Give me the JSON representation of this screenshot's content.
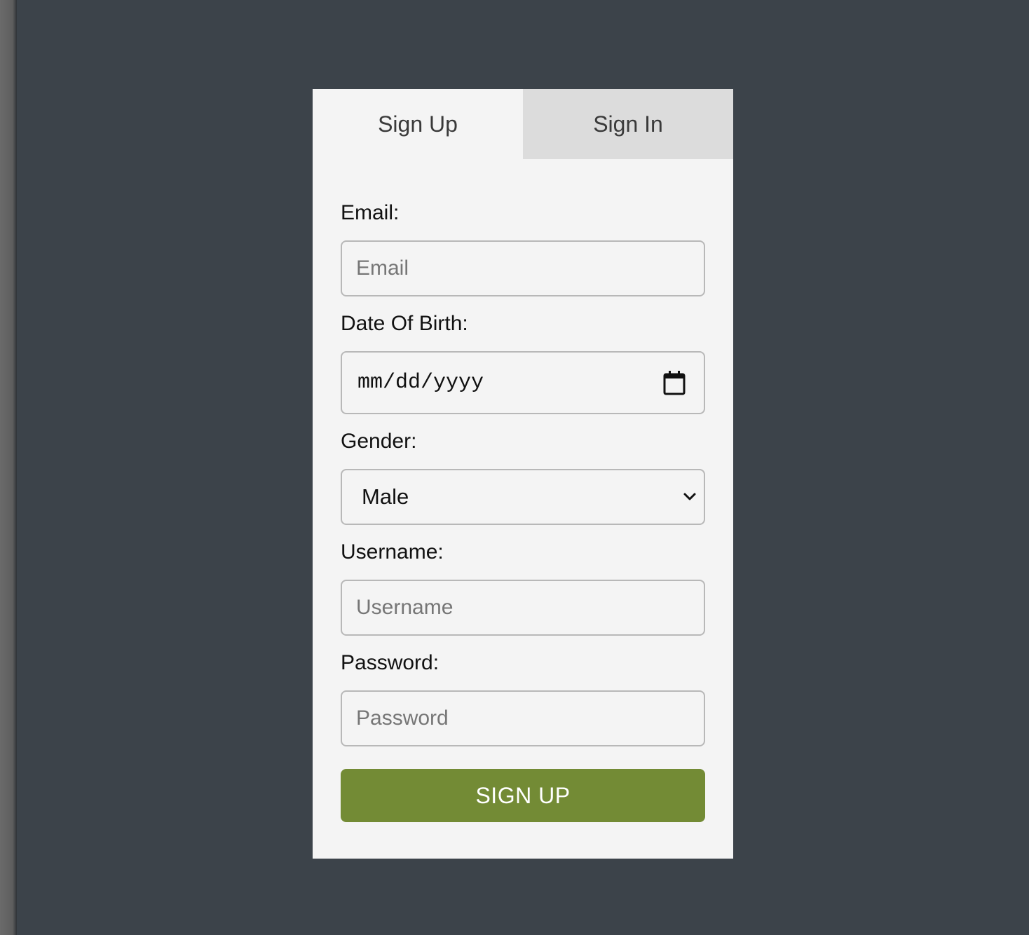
{
  "tabs": {
    "sign_up": "Sign Up",
    "sign_in": "Sign In",
    "active": "sign_up"
  },
  "form": {
    "email": {
      "label": "Email:",
      "placeholder": "Email",
      "value": ""
    },
    "dob": {
      "label": "Date Of Birth:",
      "value_display": "mm/dd/yyyy",
      "icon": "calendar-icon"
    },
    "gender": {
      "label": "Gender:",
      "selected": "Male",
      "icon": "chevron-down-icon"
    },
    "username": {
      "label": "Username:",
      "placeholder": "Username",
      "value": ""
    },
    "password": {
      "label": "Password:",
      "placeholder": "Password",
      "value": ""
    },
    "submit_label": "SIGN UP"
  },
  "colors": {
    "page_background": "#3c434a",
    "card_background": "#f4f4f4",
    "inactive_tab": "#dcdcdc",
    "submit_button": "#738b35"
  }
}
